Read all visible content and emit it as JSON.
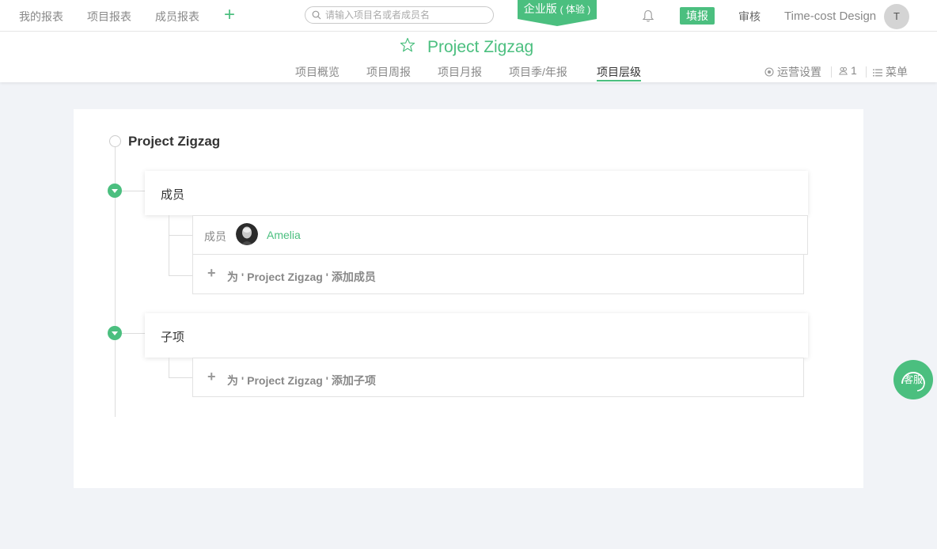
{
  "topbar": {
    "nav": [
      "我的报表",
      "项目报表",
      "成员报表"
    ],
    "add_icon": "plus-icon",
    "search_placeholder": "请输入项目名或者成员名",
    "enterprise_label": "企业版",
    "enterprise_trial": "( 体验 )",
    "notification_icon": "bell-icon",
    "fill_button": "填报",
    "audit_link": "审核",
    "company_name": "Time-cost Design",
    "avatar_initial": "T"
  },
  "project": {
    "title": "Project Zigzag",
    "favorite_icon": "star-icon",
    "tabs": [
      "项目概览",
      "项目周报",
      "项目月报",
      "项目季/年报",
      "项目层级"
    ],
    "active_tab": "项目层级",
    "tools": {
      "ops_settings": "运营设置",
      "member_count": "1",
      "menu": "菜单"
    }
  },
  "hierarchy": {
    "root_title": "Project Zigzag",
    "members_section": {
      "label": "成员",
      "member_role_label": "成员",
      "member_name": "Amelia",
      "add_text": "为 ' Project Zigzag ' 添加成员"
    },
    "children_section": {
      "label": "子项",
      "add_text": "为 ' Project Zigzag ' 添加子项"
    }
  },
  "support": {
    "label": "客服"
  },
  "colors": {
    "accent": "#4bbf7f",
    "background": "#f1f3f7"
  }
}
